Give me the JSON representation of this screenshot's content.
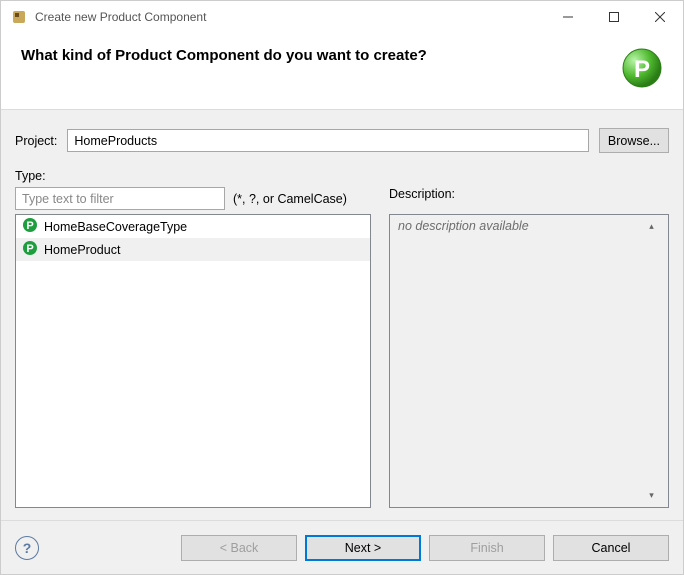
{
  "window": {
    "title": "Create new Product Component"
  },
  "banner": {
    "heading": "What kind of Product Component do you want to create?"
  },
  "project": {
    "label": "Project:",
    "value": "HomeProducts",
    "browse": "Browse..."
  },
  "type": {
    "label": "Type:",
    "filter_placeholder": "Type text to filter",
    "filter_hint": "(*, ?, or CamelCase)",
    "items": [
      {
        "label": "HomeBaseCoverageType",
        "selected": false
      },
      {
        "label": "HomeProduct",
        "selected": true
      }
    ]
  },
  "description": {
    "label": "Description:",
    "text": "no description available"
  },
  "buttons": {
    "back": "< Back",
    "next": "Next >",
    "finish": "Finish",
    "cancel": "Cancel"
  }
}
